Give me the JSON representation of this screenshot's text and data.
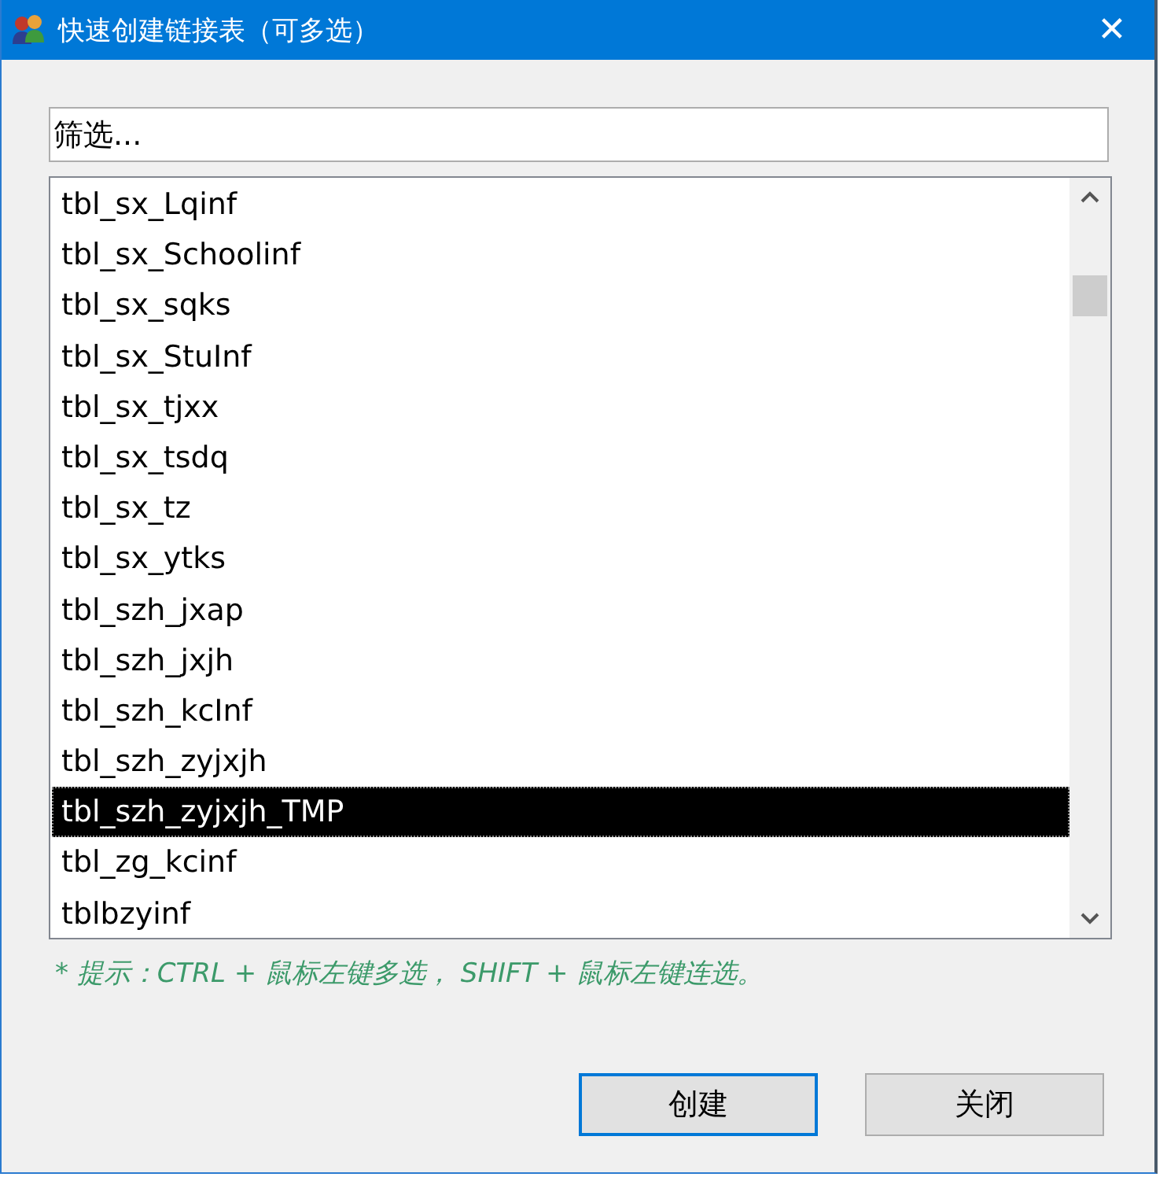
{
  "window": {
    "title": "快速创建链接表（可多选）",
    "close": "✕"
  },
  "filter": {
    "value": "筛选..."
  },
  "list": {
    "items": [
      {
        "label": "tbl_sx_Lqinf",
        "selected": false
      },
      {
        "label": "tbl_sx_Schoolinf",
        "selected": false
      },
      {
        "label": "tbl_sx_sqks",
        "selected": false
      },
      {
        "label": "tbl_sx_StuInf",
        "selected": false
      },
      {
        "label": "tbl_sx_tjxx",
        "selected": false
      },
      {
        "label": "tbl_sx_tsdq",
        "selected": false
      },
      {
        "label": "tbl_sx_tz",
        "selected": false
      },
      {
        "label": "tbl_sx_ytks",
        "selected": false
      },
      {
        "label": "tbl_szh_jxap",
        "selected": false
      },
      {
        "label": "tbl_szh_jxjh",
        "selected": false
      },
      {
        "label": "tbl_szh_kcInf",
        "selected": false
      },
      {
        "label": "tbl_szh_zyjxjh",
        "selected": false
      },
      {
        "label": "tbl_szh_zyjxjh_TMP",
        "selected": true
      },
      {
        "label": "tbl_zg_kcinf",
        "selected": false
      },
      {
        "label": "tblbzyinf",
        "selected": false
      }
    ]
  },
  "hint": "* 提示：CTRL + 鼠标左键多选， SHIFT + 鼠标左键连选。",
  "buttons": [
    {
      "label": "创建",
      "default": true
    },
    {
      "label": "关闭",
      "default": false
    }
  ]
}
